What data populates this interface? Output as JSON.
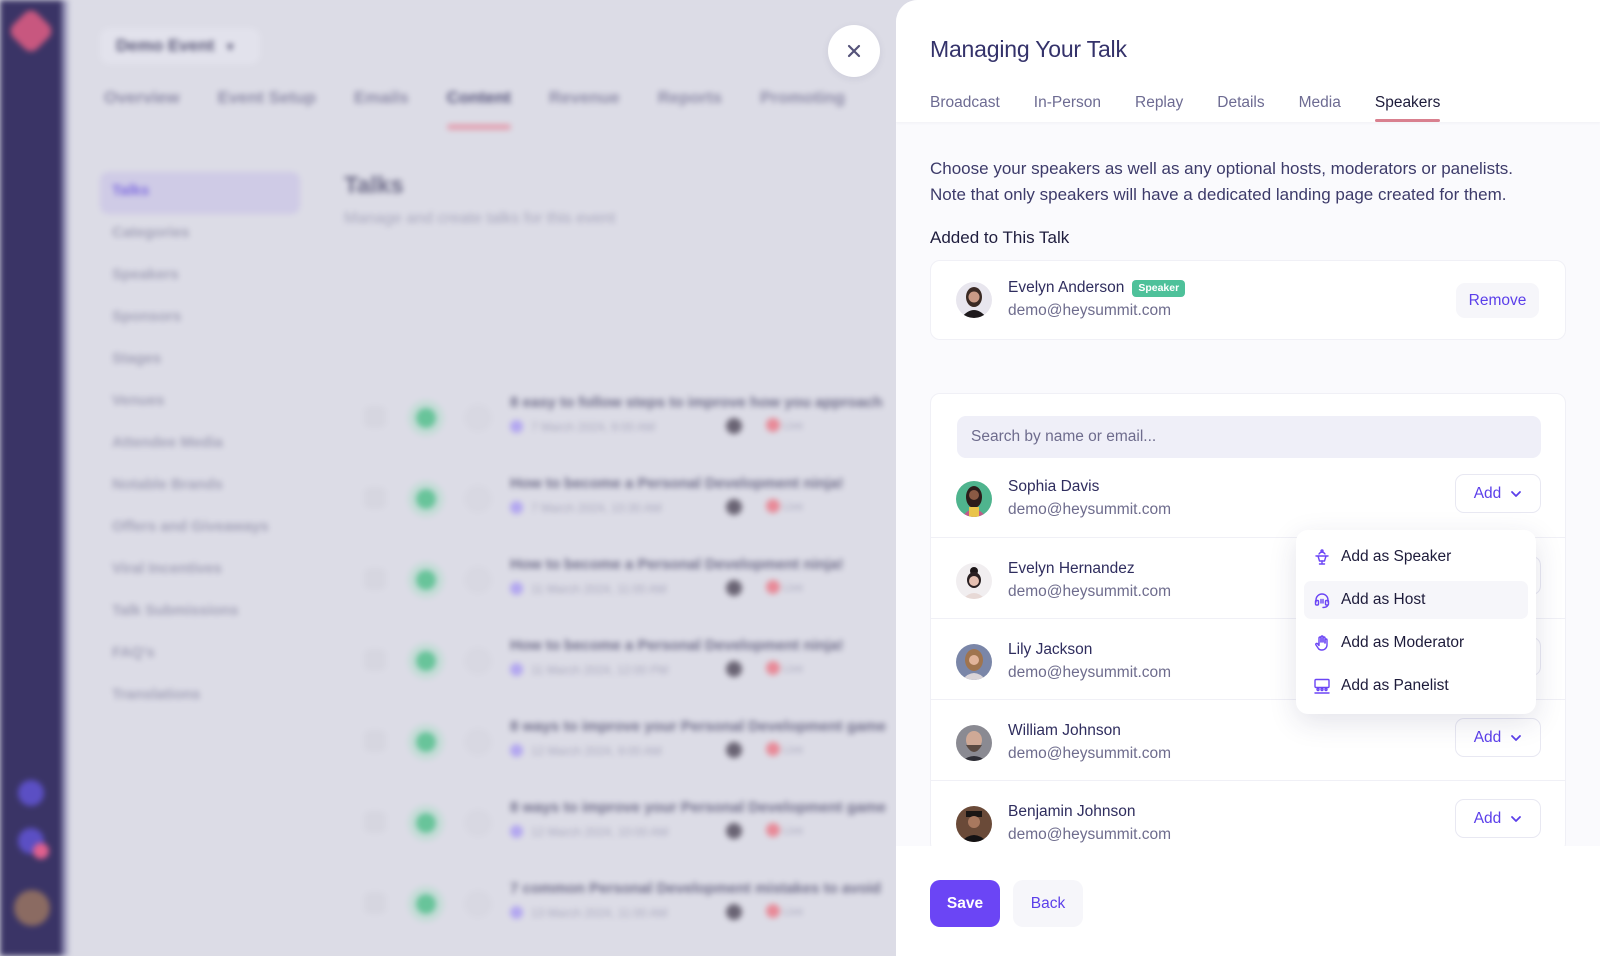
{
  "background": {
    "event_selector": "Demo Event",
    "top_tabs": [
      "Overview",
      "Event Setup",
      "Emails",
      "Content",
      "Revenue",
      "Reports",
      "Promoting"
    ],
    "active_top_tab": "Content",
    "sub_nav": [
      "Talks",
      "Categories",
      "Speakers",
      "Sponsors",
      "Stages",
      "Venues",
      "Attendee Media",
      "Notable Brands",
      "Offers and Giveaways",
      "Viral Incentives",
      "Talk Submissions",
      "FAQ's",
      "Translations"
    ],
    "active_sub_nav": "Talks",
    "talks_title": "Talks",
    "talks_subtitle": "Manage and create talks for this event",
    "talks": [
      {
        "title": "8 easy to follow steps to improve how you approach",
        "meta": "7 March 2024, 9:00 AM",
        "status": "Live"
      },
      {
        "title": "How to become a Personal Development ninja!",
        "meta": "7 March 2024, 10:30 AM",
        "status": "Live"
      },
      {
        "title": "How to become a Personal Development ninja!",
        "meta": "11 March 2024, 11:00 AM",
        "status": "Live"
      },
      {
        "title": "How to become a Personal Development ninja!",
        "meta": "11 March 2024, 12:00 PM",
        "status": "Live"
      },
      {
        "title": "8 ways to improve your Personal Development game",
        "meta": "12 March 2024, 9:00 AM",
        "status": "Live"
      },
      {
        "title": "8 ways to improve your Personal Development game",
        "meta": "12 March 2024, 10:00 AM",
        "status": "Live"
      },
      {
        "title": "7 common Personal Development mistakes to avoid",
        "meta": "13 March 2024, 11:00 AM",
        "status": "Live"
      }
    ]
  },
  "close_button": {
    "icon": "close-icon"
  },
  "panel": {
    "title": "Managing Your Talk",
    "tabs": [
      {
        "label": "Broadcast",
        "active": false
      },
      {
        "label": "In-Person",
        "active": false
      },
      {
        "label": "Replay",
        "active": false
      },
      {
        "label": "Details",
        "active": false
      },
      {
        "label": "Media",
        "active": false
      },
      {
        "label": "Speakers",
        "active": true
      }
    ],
    "intro_line1": "Choose your speakers as well as any optional hosts, moderators or panelists.",
    "intro_line2": "Note that only speakers will have a dedicated landing page created for them.",
    "added_heading": "Added to This Talk",
    "added": [
      {
        "name": "Evelyn Anderson",
        "email": "demo@heysummit.com",
        "role": "Speaker",
        "action": "Remove"
      }
    ],
    "search": {
      "placeholder": "Search by name or email...",
      "value": ""
    },
    "candidates": [
      {
        "name": "Sophia Davis",
        "email": "demo@heysummit.com",
        "action": "Add"
      },
      {
        "name": "Evelyn Hernandez",
        "email": "demo@heysummit.com",
        "action": "Add"
      },
      {
        "name": "Lily Jackson",
        "email": "demo@heysummit.com",
        "action": "Add"
      },
      {
        "name": "William Johnson",
        "email": "demo@heysummit.com",
        "action": "Add"
      },
      {
        "name": "Benjamin Johnson",
        "email": "demo@heysummit.com",
        "action": "Add"
      }
    ],
    "dropdown": {
      "open_for": "Sophia Davis",
      "items": [
        {
          "label": "Add as Speaker",
          "icon": "podium-icon"
        },
        {
          "label": "Add as Host",
          "icon": "headset-icon",
          "hovered": true
        },
        {
          "label": "Add as Moderator",
          "icon": "hand-icon"
        },
        {
          "label": "Add as Panelist",
          "icon": "panel-table-icon"
        }
      ]
    },
    "footer": {
      "save_label": "Save",
      "back_label": "Back"
    }
  },
  "colors": {
    "accent": "#6b45f5",
    "accent_text": "#5b3fea",
    "badge_green": "#4ec19a",
    "tab_underline": "#d9808f",
    "rail": "#3a3466"
  }
}
